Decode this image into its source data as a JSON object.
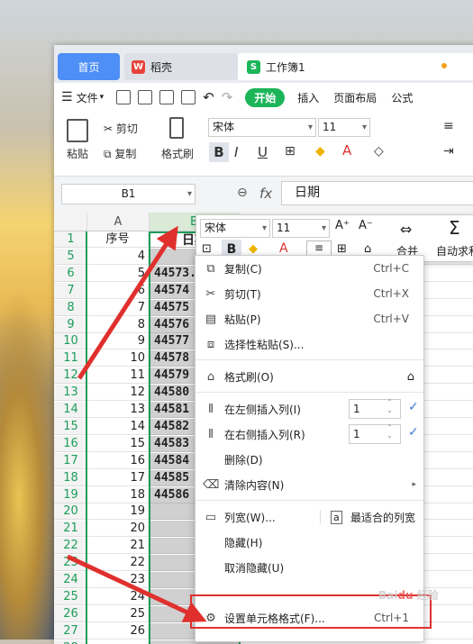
{
  "window": {
    "tabs": [
      {
        "label": "首页"
      },
      {
        "label": "稻壳"
      },
      {
        "label": "工作簿1"
      }
    ]
  },
  "menubar": {
    "file": "文件",
    "start": "开始",
    "insert": "插入",
    "page_layout": "页面布局",
    "formula": "公式"
  },
  "ribbon": {
    "paste": "粘贴",
    "cut": "剪切",
    "copy": "复制",
    "format_painter": "格式刷",
    "font": "宋体",
    "size": "11"
  },
  "formula_bar": {
    "cell_ref": "B1",
    "fx": "fx",
    "value": "日期"
  },
  "grid": {
    "col_A": "A",
    "col_B": "B",
    "header_A": "序号",
    "header_B": "日期",
    "rows": [
      {
        "row": "1",
        "a": "序号",
        "b": "日期"
      },
      {
        "row": "5",
        "a": "4",
        "b": ""
      },
      {
        "row": "6",
        "a": "5",
        "b": "44573.00"
      },
      {
        "row": "7",
        "a": "6",
        "b": "44574"
      },
      {
        "row": "8",
        "a": "7",
        "b": "44575"
      },
      {
        "row": "9",
        "a": "8",
        "b": "44576"
      },
      {
        "row": "10",
        "a": "9",
        "b": "44577"
      },
      {
        "row": "11",
        "a": "10",
        "b": "44578"
      },
      {
        "row": "12",
        "a": "11",
        "b": "44579"
      },
      {
        "row": "13",
        "a": "12",
        "b": "44580"
      },
      {
        "row": "14",
        "a": "13",
        "b": "44581"
      },
      {
        "row": "15",
        "a": "14",
        "b": "44582"
      },
      {
        "row": "16",
        "a": "15",
        "b": "44583"
      },
      {
        "row": "17",
        "a": "16",
        "b": "44584"
      },
      {
        "row": "18",
        "a": "17",
        "b": "44585"
      },
      {
        "row": "19",
        "a": "18",
        "b": "44586"
      },
      {
        "row": "20",
        "a": "19",
        "b": ""
      },
      {
        "row": "21",
        "a": "20",
        "b": ""
      },
      {
        "row": "22",
        "a": "21",
        "b": ""
      },
      {
        "row": "23",
        "a": "22",
        "b": ""
      },
      {
        "row": "24",
        "a": "23",
        "b": ""
      },
      {
        "row": "25",
        "a": "24",
        "b": ""
      },
      {
        "row": "26",
        "a": "25",
        "b": ""
      },
      {
        "row": "27",
        "a": "26",
        "b": ""
      },
      {
        "row": "28",
        "a": "",
        "b": ""
      }
    ]
  },
  "mini_toolbar": {
    "font": "宋体",
    "size": "11",
    "merge": "合并",
    "autosum": "自动求和"
  },
  "context_menu": {
    "items": [
      {
        "label": "复制(C)",
        "shortcut": "Ctrl+C"
      },
      {
        "label": "剪切(T)",
        "shortcut": "Ctrl+X"
      },
      {
        "label": "粘贴(P)",
        "shortcut": "Ctrl+V"
      },
      {
        "label": "选择性粘贴(S)..."
      },
      {
        "label": "格式刷(O)"
      },
      {
        "label": "在左侧插入列(I)",
        "value": "1"
      },
      {
        "label": "在右侧插入列(R)",
        "value": "1"
      },
      {
        "label": "删除(D)"
      },
      {
        "label": "清除内容(N)"
      },
      {
        "label": "列宽(W)...",
        "extra": "最适合的列宽"
      },
      {
        "label": "隐藏(H)"
      },
      {
        "label": "取消隐藏(U)"
      },
      {
        "label": "设置单元格格式(F)...",
        "shortcut": "Ctrl+1"
      }
    ]
  },
  "accent": "#e0302d"
}
